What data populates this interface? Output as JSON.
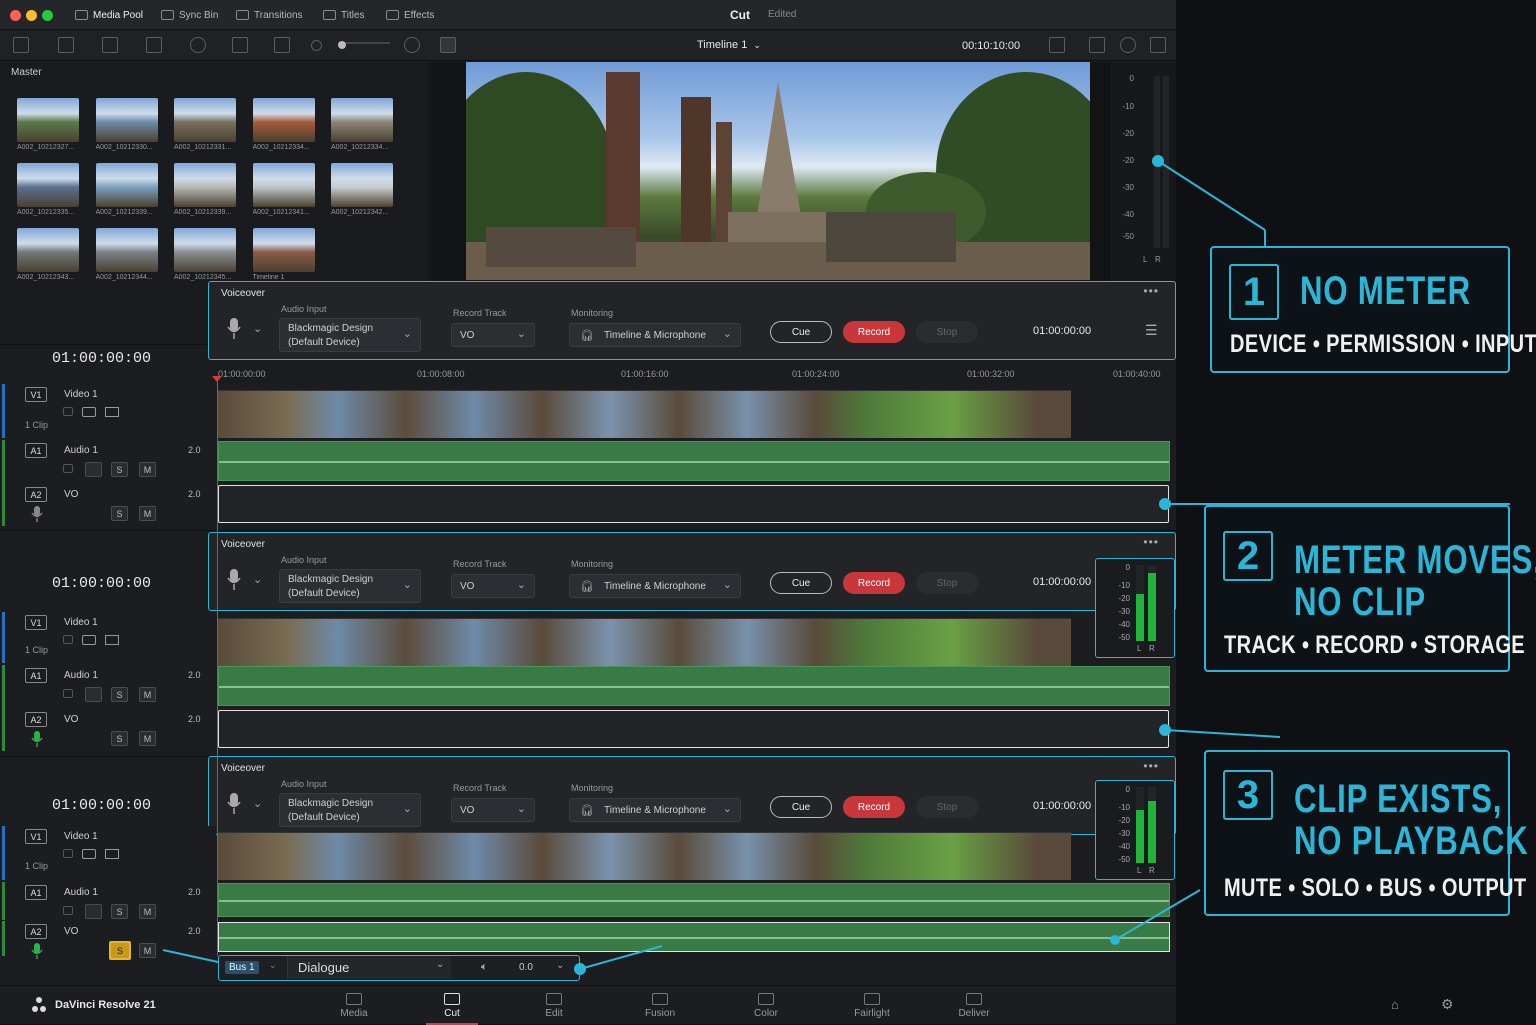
{
  "window": {
    "title": "Cut",
    "status": "Edited"
  },
  "topbar": {
    "media_pool": "Media Pool",
    "sync_bin": "Sync Bin",
    "transitions": "Transitions",
    "titles": "Titles",
    "effects": "Effects"
  },
  "toolbar": {
    "timeline_name": "Timeline 1",
    "timecode": "00:10:10:00"
  },
  "pool": {
    "bin": "Master",
    "clips": [
      {
        "label": "A002_10212327..."
      },
      {
        "label": "A002_10212330..."
      },
      {
        "label": "A002_10212331..."
      },
      {
        "label": "A002_10212334..."
      },
      {
        "label": "A002_10212334..."
      },
      {
        "label": "A002_10212335..."
      },
      {
        "label": "A002_10212339..."
      },
      {
        "label": "A002_10212339..."
      },
      {
        "label": "A002_10212341..."
      },
      {
        "label": "A002_10212342..."
      },
      {
        "label": "A002_10212343..."
      },
      {
        "label": "A002_10212344..."
      },
      {
        "label": "A002_10212345..."
      },
      {
        "label": "Timeline 1"
      }
    ]
  },
  "meter_ticks": [
    "0",
    "-10",
    "-20",
    "-20",
    "-30",
    "-40",
    "-50"
  ],
  "mini_meter_ticks": [
    "0",
    "-10",
    "-20",
    "-30",
    "-40",
    "-50"
  ],
  "lr": {
    "l": "L",
    "r": "R"
  },
  "voiceover": {
    "title": "Voiceover",
    "audio_input_label": "Audio Input",
    "device_line1": "Blackmagic Design",
    "device_line2": "(Default Device)",
    "record_track_label": "Record Track",
    "record_track": "VO",
    "monitoring_label": "Monitoring",
    "monitoring": "Timeline & Microphone",
    "cue": "Cue",
    "record": "Record",
    "stop": "Stop",
    "timecode": "01:00:00:00"
  },
  "timeline": {
    "timecode": "01:00:00:00",
    "ruler": [
      "01:00:00:00",
      "01:00:08:00",
      "01:00:16:00",
      "01:00:24:00",
      "01:00:32:00",
      "01:00:40:00"
    ],
    "v1": {
      "tag": "V1",
      "name": "Video 1",
      "clips": "1 Clip"
    },
    "a1": {
      "tag": "A1",
      "name": "Audio 1",
      "ch": "2.0"
    },
    "a2": {
      "tag": "A2",
      "name": "VO",
      "ch": "2.0"
    },
    "solo": "S",
    "mute": "M"
  },
  "bus_strip": {
    "bus": "Bus 1",
    "name": "Dialogue",
    "volume": "0.0"
  },
  "nav": {
    "brand": "DaVinci Resolve 21",
    "items": [
      "Media",
      "Cut",
      "Edit",
      "Fusion",
      "Color",
      "Fairlight",
      "Deliver"
    ],
    "active": "Cut"
  },
  "callouts": [
    {
      "num": "1",
      "head1": "NO METER",
      "head2": "",
      "sub": "DEVICE • PERMISSION • INPUT"
    },
    {
      "num": "2",
      "head1": "METER MOVES,",
      "head2": "NO CLIP",
      "sub": "TRACK • RECORD • STORAGE"
    },
    {
      "num": "3",
      "head1": "CLIP EXISTS,",
      "head2": "NO PLAYBACK",
      "sub": "MUTE • SOLO • BUS • OUTPUT"
    }
  ],
  "colors": {
    "accent": "#2bb6d8",
    "record": "#d93a3a",
    "audio_clip": "#3a7a46",
    "meter": "#22b33a"
  }
}
